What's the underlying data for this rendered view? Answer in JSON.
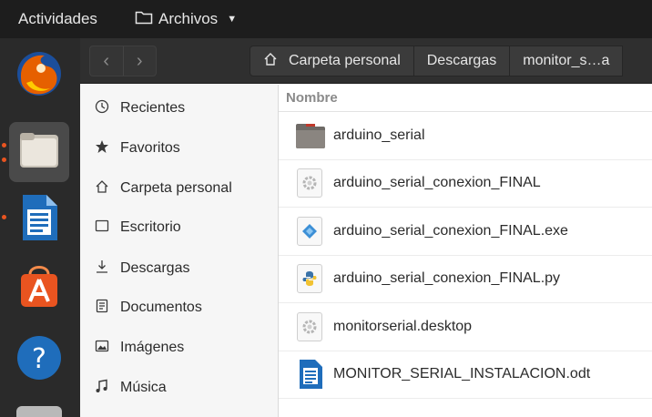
{
  "topbar": {
    "activities": "Actividades",
    "app_name": "Archivos",
    "caret": "▼"
  },
  "dock": {
    "items": [
      {
        "name": "firefox-icon"
      },
      {
        "name": "files-icon",
        "active": true
      },
      {
        "name": "writer-icon"
      },
      {
        "name": "software-center-icon"
      },
      {
        "name": "help-icon"
      }
    ]
  },
  "header": {
    "back": "‹",
    "forward": "›",
    "breadcrumbs": [
      "Carpeta personal",
      "Descargas",
      "monitor_s…a"
    ]
  },
  "sidebar": {
    "items": [
      {
        "label": "Recientes",
        "icon": "clock-icon"
      },
      {
        "label": "Favoritos",
        "icon": "star-icon"
      },
      {
        "label": "Carpeta personal",
        "icon": "home-icon"
      },
      {
        "label": "Escritorio",
        "icon": "desktop-icon"
      },
      {
        "label": "Descargas",
        "icon": "download-icon"
      },
      {
        "label": "Documentos",
        "icon": "document-icon"
      },
      {
        "label": "Imágenes",
        "icon": "image-icon"
      },
      {
        "label": "Música",
        "icon": "music-icon"
      }
    ]
  },
  "list": {
    "column": "Nombre",
    "rows": [
      {
        "name": "arduino_serial",
        "icon": "folder-icon"
      },
      {
        "name": "arduino_serial_conexion_FINAL",
        "icon": "executable-icon"
      },
      {
        "name": "arduino_serial_conexion_FINAL.exe",
        "icon": "wine-exe-icon"
      },
      {
        "name": "arduino_serial_conexion_FINAL.py",
        "icon": "python-file-icon"
      },
      {
        "name": "monitorserial.desktop",
        "icon": "desktop-file-icon"
      },
      {
        "name": "MONITOR_SERIAL_INSTALACION.odt",
        "icon": "odt-document-icon"
      }
    ]
  },
  "colors": {
    "topbar": "#1d1d1d",
    "dock": "#2a2a2a",
    "accent": "#e95420",
    "header": "#2f2f2f"
  }
}
